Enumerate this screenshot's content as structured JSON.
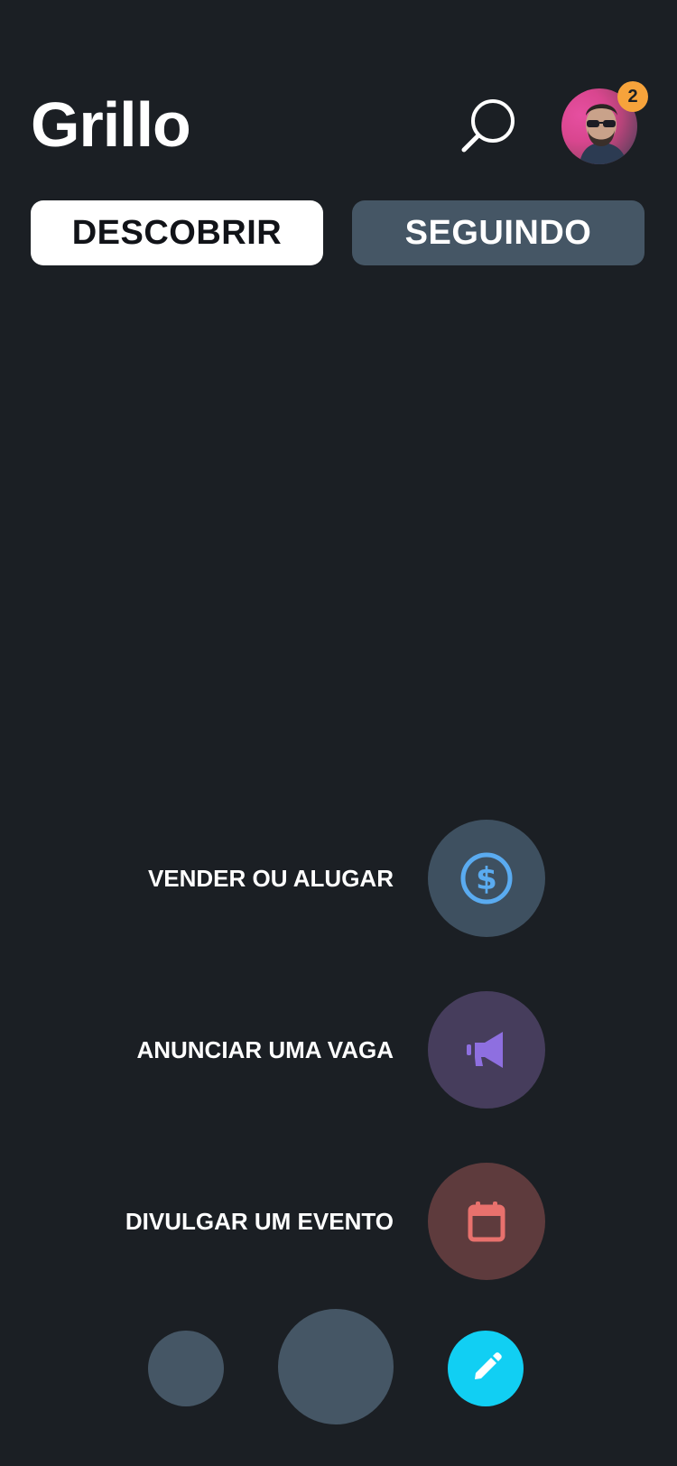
{
  "app": {
    "title": "Grillo",
    "notifications_count": "2"
  },
  "tabs": [
    {
      "label": "DESCOBRIR",
      "active": true
    },
    {
      "label": "SEGUINDO",
      "active": false
    }
  ],
  "actions": [
    {
      "label": "VENDER OU ALUGAR",
      "icon": "dollar-circle-icon",
      "color": "#5aabf0"
    },
    {
      "label": "ANUNCIAR UMA VAGA",
      "icon": "megaphone-icon",
      "color": "#8e6fe0"
    },
    {
      "label": "DIVULGAR UM EVENTO",
      "icon": "calendar-icon",
      "color": "#e8716d"
    }
  ],
  "bottom_bar": {
    "edit_icon": "pencil-icon",
    "edit_color": "#11cff3"
  },
  "colors": {
    "background": "#1b1f24",
    "tab_active_bg": "#ffffff",
    "tab_inactive_bg": "#455665",
    "badge": "#f7a33b"
  }
}
